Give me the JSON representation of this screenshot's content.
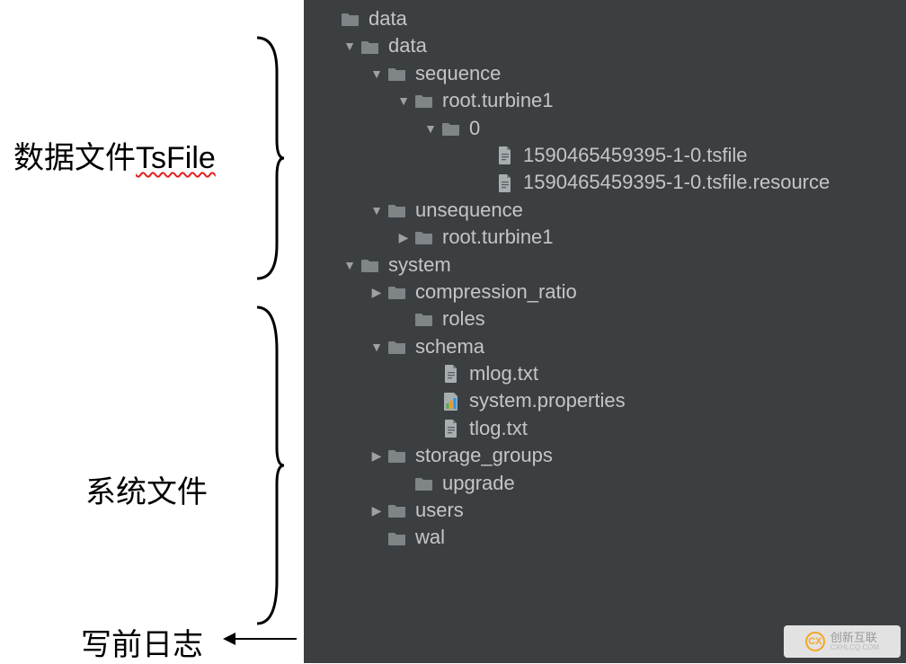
{
  "labels": {
    "data_files": "数据文件",
    "tsfile": "TsFile",
    "system_files": "系统文件",
    "wal_log": "写前日志"
  },
  "tree": [
    {
      "indent": 0,
      "arrow": "none",
      "icon": "folder",
      "name": "data"
    },
    {
      "indent": 1,
      "arrow": "down",
      "icon": "folder",
      "name": "data"
    },
    {
      "indent": 2,
      "arrow": "down",
      "icon": "folder",
      "name": "sequence"
    },
    {
      "indent": 3,
      "arrow": "down",
      "icon": "folder",
      "name": "root.turbine1"
    },
    {
      "indent": 4,
      "arrow": "down",
      "icon": "folder",
      "name": "0"
    },
    {
      "indent": 6,
      "arrow": "none",
      "icon": "file",
      "name": "1590465459395-1-0.tsfile"
    },
    {
      "indent": 6,
      "arrow": "none",
      "icon": "file",
      "name": "1590465459395-1-0.tsfile.resource"
    },
    {
      "indent": 2,
      "arrow": "down",
      "icon": "folder",
      "name": "unsequence"
    },
    {
      "indent": 3,
      "arrow": "right",
      "icon": "folder",
      "name": "root.turbine1"
    },
    {
      "indent": 1,
      "arrow": "down",
      "icon": "folder",
      "name": "system"
    },
    {
      "indent": 2,
      "arrow": "right",
      "icon": "folder",
      "name": "compression_ratio"
    },
    {
      "indent": 3,
      "arrow": "none",
      "icon": "folder",
      "name": "roles"
    },
    {
      "indent": 2,
      "arrow": "down",
      "icon": "folder",
      "name": "schema"
    },
    {
      "indent": 4,
      "arrow": "none",
      "icon": "file",
      "name": "mlog.txt"
    },
    {
      "indent": 4,
      "arrow": "none",
      "icon": "props",
      "name": "system.properties"
    },
    {
      "indent": 4,
      "arrow": "none",
      "icon": "file",
      "name": "tlog.txt"
    },
    {
      "indent": 2,
      "arrow": "right",
      "icon": "folder",
      "name": "storage_groups"
    },
    {
      "indent": 3,
      "arrow": "none",
      "icon": "folder",
      "name": "upgrade"
    },
    {
      "indent": 2,
      "arrow": "right",
      "icon": "folder",
      "name": "users"
    },
    {
      "indent": 2,
      "arrow": "none",
      "icon": "folder",
      "name": "wal"
    }
  ],
  "watermark": {
    "logo_text": "CX",
    "main": "创新互联",
    "sub": "CXHLCQ.COM"
  }
}
